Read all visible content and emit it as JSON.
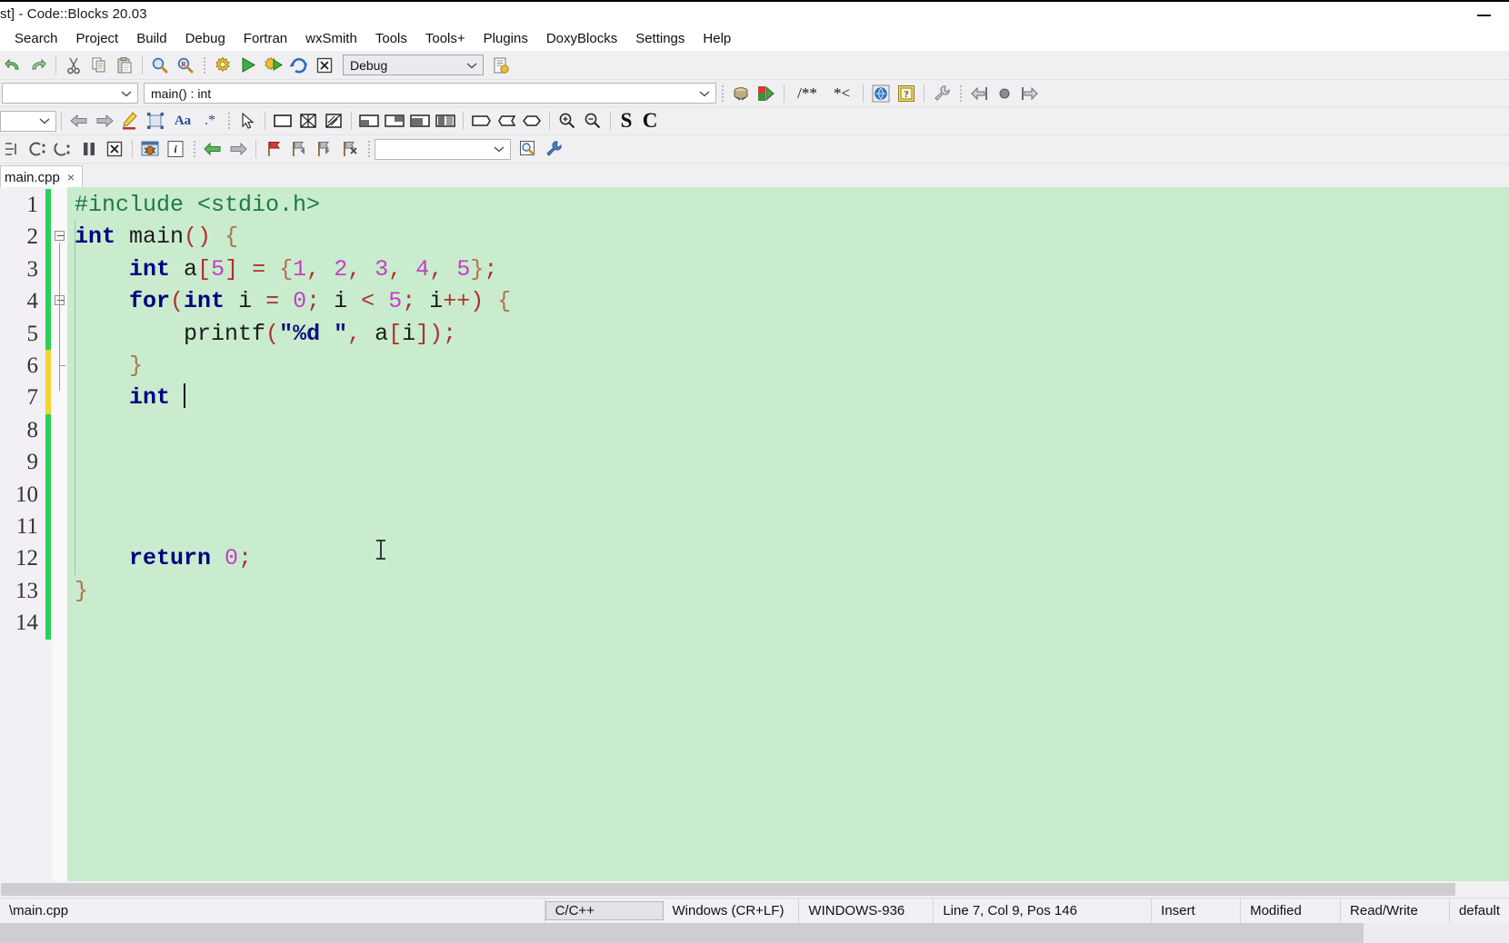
{
  "window": {
    "title": "st] - Code::Blocks 20.03",
    "minimize_label": "Minimize"
  },
  "menubar": {
    "items": [
      {
        "label": "Search"
      },
      {
        "label": "Project"
      },
      {
        "label": "Build"
      },
      {
        "label": "Debug"
      },
      {
        "label": "Fortran"
      },
      {
        "label": "wxSmith"
      },
      {
        "label": "Tools"
      },
      {
        "label": "Tools+"
      },
      {
        "label": "Plugins"
      },
      {
        "label": "DoxyBlocks"
      },
      {
        "label": "Settings"
      },
      {
        "label": "Help"
      }
    ]
  },
  "toolbar_main": {
    "icons": [
      {
        "name": "undo-icon",
        "title": "Undo"
      },
      {
        "name": "redo-icon",
        "title": "Redo"
      },
      {
        "name": "cut-icon",
        "title": "Cut"
      },
      {
        "name": "copy-icon",
        "title": "Copy"
      },
      {
        "name": "paste-icon",
        "title": "Paste"
      },
      {
        "name": "find-icon",
        "title": "Find"
      },
      {
        "name": "replace-icon",
        "title": "Replace"
      }
    ],
    "build_icons": [
      {
        "name": "build-icon",
        "title": "Build"
      },
      {
        "name": "run-icon",
        "title": "Run"
      },
      {
        "name": "build-and-run-icon",
        "title": "Build and run"
      },
      {
        "name": "rebuild-icon",
        "title": "Rebuild"
      },
      {
        "name": "abort-icon",
        "title": "Abort"
      }
    ],
    "target_select": {
      "value": "Debug",
      "placeholder": "Debug"
    },
    "build_target_options_icon": "build-target-options-icon"
  },
  "toolbar_symbols": {
    "scope_select": {
      "value": "",
      "placeholder": ""
    },
    "function_select": {
      "value": "main() : int",
      "placeholder": "main() : int"
    },
    "icons": [
      {
        "name": "class-browser-icon",
        "title": "Class browser"
      },
      {
        "name": "doxyblocks-extract-icon",
        "title": "Extract documentation"
      },
      {
        "name": "comment-block-icon",
        "title": "/** */ block comment"
      },
      {
        "name": "comment-line-icon",
        "title": "*< line comment"
      },
      {
        "name": "doxyblocks-run-icon",
        "title": "Run DoxyBlocks"
      },
      {
        "name": "doxyblocks-help-icon",
        "title": "DoxyBlocks help"
      },
      {
        "name": "doxyblocks-config-icon",
        "title": "Configure DoxyBlocks"
      },
      {
        "name": "wrap-left-icon",
        "title": "Wrap left"
      },
      {
        "name": "record-icon",
        "title": "Record"
      },
      {
        "name": "wrap-right-icon",
        "title": "Wrap right"
      }
    ]
  },
  "toolbar_wxsmith": {
    "select": {
      "value": "",
      "placeholder": ""
    },
    "nav_icons": [
      {
        "name": "back-icon",
        "title": "Back"
      },
      {
        "name": "forward-icon",
        "title": "Forward"
      },
      {
        "name": "highlight-icon",
        "title": "Highlight"
      },
      {
        "name": "resize-icon",
        "title": "Resize"
      },
      {
        "name": "font-icon",
        "title": "Font"
      },
      {
        "name": "wildcard-icon",
        "title": "Regex"
      }
    ],
    "layout_icons": [
      {
        "name": "pointer-icon",
        "title": "Select"
      },
      {
        "name": "panel-icon",
        "title": "Panel"
      },
      {
        "name": "grid-sizer-icon",
        "title": "Grid sizer"
      },
      {
        "name": "flex-sizer-icon",
        "title": "Flex grid sizer"
      },
      {
        "name": "box-sizer-top-icon",
        "title": "Box sizer"
      },
      {
        "name": "box-sizer-right-icon",
        "title": "Box sizer"
      },
      {
        "name": "box-sizer-left-icon",
        "title": "Box sizer"
      },
      {
        "name": "box-sizer-split-icon",
        "title": "Box sizer"
      },
      {
        "name": "spacer-left-icon",
        "title": "Spacer"
      },
      {
        "name": "spacer-mid-icon",
        "title": "Spacer"
      },
      {
        "name": "spacer-right-icon",
        "title": "Spacer"
      },
      {
        "name": "zoom-in-icon",
        "title": "Zoom in"
      },
      {
        "name": "zoom-out-icon",
        "title": "Zoom out"
      }
    ],
    "letter_icons": [
      {
        "name": "letter-s-icon",
        "label": "S"
      },
      {
        "name": "letter-c-icon",
        "label": "C"
      }
    ]
  },
  "toolbar_debug": {
    "icons": [
      {
        "name": "step-into-icon",
        "title": "Step into"
      },
      {
        "name": "step-over-icon",
        "title": "Next line"
      },
      {
        "name": "step-out-icon",
        "title": "Step out"
      },
      {
        "name": "pause-icon",
        "title": "Break debugger"
      },
      {
        "name": "stop-debug-icon",
        "title": "Stop debugger"
      },
      {
        "name": "debug-window-icon",
        "title": "Debugging windows"
      },
      {
        "name": "debug-info-icon",
        "title": "Various info"
      },
      {
        "name": "prev-bookmark-icon",
        "title": "Previous"
      },
      {
        "name": "next-bookmark-icon",
        "title": "Next"
      },
      {
        "name": "flag-icon",
        "title": "Toggle bookmark"
      },
      {
        "name": "bookmark-prev-icon",
        "title": "Previous bookmark"
      },
      {
        "name": "bookmark-next-icon",
        "title": "Next bookmark"
      },
      {
        "name": "bookmark-clear-icon",
        "title": "Clear bookmarks"
      }
    ],
    "search_select": {
      "value": "",
      "placeholder": ""
    },
    "search_icons": [
      {
        "name": "search-icon",
        "title": "Search"
      },
      {
        "name": "search-options-icon",
        "title": "Search options"
      }
    ]
  },
  "editor": {
    "tabs": [
      {
        "label": "main.cpp",
        "close_label": "×",
        "active": true
      }
    ],
    "line_count": 14,
    "lines": [
      {
        "n": 1,
        "tokens": [
          {
            "t": "#include <stdio.h>",
            "c": "pre"
          }
        ]
      },
      {
        "n": 2,
        "tokens": [
          {
            "t": "int",
            "c": "kw"
          },
          {
            "t": " main",
            "c": "id"
          },
          {
            "t": "()",
            "c": "op"
          },
          {
            "t": " ",
            "c": "id"
          },
          {
            "t": "{",
            "c": "brc"
          }
        ]
      },
      {
        "n": 3,
        "tokens": [
          {
            "t": "    ",
            "c": "id"
          },
          {
            "t": "int",
            "c": "kw"
          },
          {
            "t": " a",
            "c": "id"
          },
          {
            "t": "[",
            "c": "op"
          },
          {
            "t": "5",
            "c": "num"
          },
          {
            "t": "]",
            "c": "op"
          },
          {
            "t": " ",
            "c": "id"
          },
          {
            "t": "=",
            "c": "op"
          },
          {
            "t": " ",
            "c": "id"
          },
          {
            "t": "{",
            "c": "brc"
          },
          {
            "t": "1",
            "c": "num"
          },
          {
            "t": ",",
            "c": "op"
          },
          {
            "t": " ",
            "c": "id"
          },
          {
            "t": "2",
            "c": "num"
          },
          {
            "t": ",",
            "c": "op"
          },
          {
            "t": " ",
            "c": "id"
          },
          {
            "t": "3",
            "c": "num"
          },
          {
            "t": ",",
            "c": "op"
          },
          {
            "t": " ",
            "c": "id"
          },
          {
            "t": "4",
            "c": "num"
          },
          {
            "t": ",",
            "c": "op"
          },
          {
            "t": " ",
            "c": "id"
          },
          {
            "t": "5",
            "c": "num"
          },
          {
            "t": "}",
            "c": "brc"
          },
          {
            "t": ";",
            "c": "op"
          }
        ]
      },
      {
        "n": 4,
        "tokens": [
          {
            "t": "    ",
            "c": "id"
          },
          {
            "t": "for",
            "c": "kw"
          },
          {
            "t": "(",
            "c": "op"
          },
          {
            "t": "int",
            "c": "kw"
          },
          {
            "t": " i ",
            "c": "id"
          },
          {
            "t": "=",
            "c": "op"
          },
          {
            "t": " ",
            "c": "id"
          },
          {
            "t": "0",
            "c": "num"
          },
          {
            "t": ";",
            "c": "op"
          },
          {
            "t": " i ",
            "c": "id"
          },
          {
            "t": "<",
            "c": "op"
          },
          {
            "t": " ",
            "c": "id"
          },
          {
            "t": "5",
            "c": "num"
          },
          {
            "t": ";",
            "c": "op"
          },
          {
            "t": " i",
            "c": "id"
          },
          {
            "t": "++)",
            "c": "op"
          },
          {
            "t": " ",
            "c": "id"
          },
          {
            "t": "{",
            "c": "brc"
          }
        ]
      },
      {
        "n": 5,
        "tokens": [
          {
            "t": "        printf",
            "c": "id"
          },
          {
            "t": "(",
            "c": "op"
          },
          {
            "t": "\"%d \"",
            "c": "str"
          },
          {
            "t": ",",
            "c": "op"
          },
          {
            "t": " a",
            "c": "id"
          },
          {
            "t": "[",
            "c": "op"
          },
          {
            "t": "i",
            "c": "id"
          },
          {
            "t": "])",
            "c": "op"
          },
          {
            "t": ";",
            "c": "op"
          }
        ]
      },
      {
        "n": 6,
        "tokens": [
          {
            "t": "    ",
            "c": "id"
          },
          {
            "t": "}",
            "c": "brc"
          }
        ]
      },
      {
        "n": 7,
        "tokens": [
          {
            "t": "    ",
            "c": "id"
          },
          {
            "t": "int",
            "c": "kw"
          },
          {
            "t": " ",
            "c": "id"
          }
        ],
        "caret": true
      },
      {
        "n": 8,
        "tokens": []
      },
      {
        "n": 9,
        "tokens": []
      },
      {
        "n": 10,
        "tokens": []
      },
      {
        "n": 11,
        "tokens": []
      },
      {
        "n": 12,
        "tokens": [
          {
            "t": "    ",
            "c": "id"
          },
          {
            "t": "return",
            "c": "kw"
          },
          {
            "t": " ",
            "c": "id"
          },
          {
            "t": "0",
            "c": "num"
          },
          {
            "t": ";",
            "c": "op"
          }
        ]
      },
      {
        "n": 13,
        "tokens": [
          {
            "t": "}",
            "c": "brc"
          }
        ]
      },
      {
        "n": 14,
        "tokens": []
      }
    ],
    "colors": {
      "background": "#c9ecce",
      "gutter": "#f2f0f4",
      "keyword": "#00007f",
      "number": "#c43fc4",
      "operator": "#b03030",
      "string": "#10107a",
      "preprocessor": "#1f7a3f",
      "brace": "#b4714f",
      "change_saved": "#2bd05a",
      "change_unsaved": "#f5d432"
    },
    "change_markers": [
      {
        "from_line": 1,
        "to_line": 5,
        "state": "saved"
      },
      {
        "from_line": 6,
        "to_line": 7,
        "state": "unsaved"
      },
      {
        "from_line": 8,
        "to_line": 14,
        "state": "saved"
      }
    ]
  },
  "statusbar": {
    "file_path": "\\main.cpp",
    "language": "C/C++",
    "line_endings": "Windows (CR+LF)",
    "encoding": "WINDOWS-936",
    "caret": "Line 7, Col 9, Pos 146",
    "insert_mode": "Insert",
    "modified": "Modified",
    "permission": "Read/Write",
    "profile": "default"
  }
}
